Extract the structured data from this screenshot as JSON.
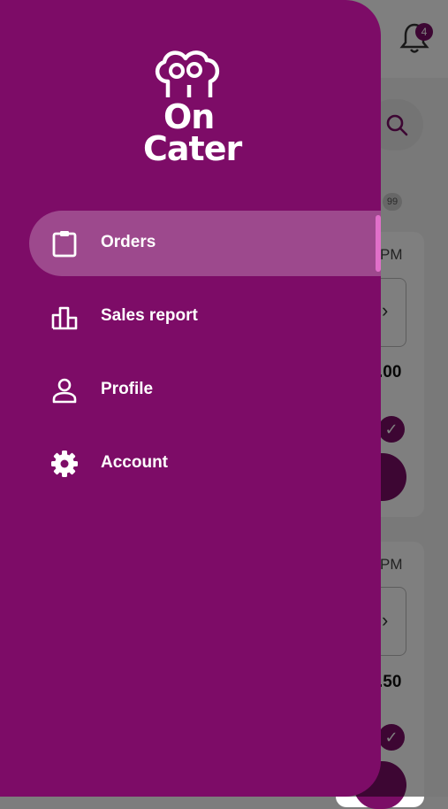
{
  "background": {
    "notifications_count": "4",
    "list_count": "99",
    "cards": [
      {
        "time": "PM",
        "price": ".00",
        "arrow": "›"
      },
      {
        "time": "PM",
        "price": ".50",
        "arrow": "›"
      }
    ]
  },
  "drawer": {
    "logo": {
      "line1": "On",
      "line2": "Cater"
    },
    "items": [
      {
        "label": "Orders",
        "icon": "clipboard-icon",
        "active": true
      },
      {
        "label": "Sales report",
        "icon": "bar-chart-icon",
        "active": false
      },
      {
        "label": "Profile",
        "icon": "person-icon",
        "active": false
      },
      {
        "label": "Account",
        "icon": "gear-icon",
        "active": false
      }
    ]
  },
  "colors": {
    "drawer_bg": "#7d0c67",
    "accent": "#7b0d66",
    "active_indicator": "#e070c9"
  }
}
